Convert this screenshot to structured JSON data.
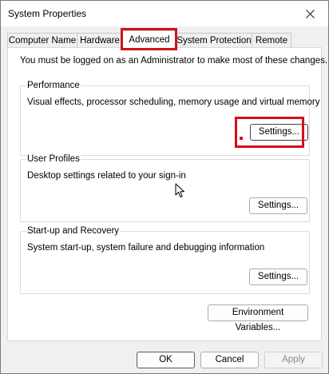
{
  "window": {
    "title": "System Properties"
  },
  "tabs": [
    {
      "label": "Computer Name"
    },
    {
      "label": "Hardware"
    },
    {
      "label": "Advanced"
    },
    {
      "label": "System Protection"
    },
    {
      "label": "Remote"
    }
  ],
  "admin_note": "You must be logged on as an Administrator to make most of these changes.",
  "groups": {
    "performance": {
      "label": "Performance",
      "description": "Visual effects, processor scheduling, memory usage and virtual memory",
      "button": "Settings..."
    },
    "user_profiles": {
      "label": "User Profiles",
      "description": "Desktop settings related to your sign-in",
      "button": "Settings..."
    },
    "startup_recovery": {
      "label": "Start-up and Recovery",
      "description": "System start-up, system failure and debugging information",
      "button": "Settings..."
    }
  },
  "env_button": "Environment Variables...",
  "footer": {
    "ok": "OK",
    "cancel": "Cancel",
    "apply": "Apply"
  },
  "colors": {
    "highlight": "#d0121b",
    "panel": "#ffffff",
    "chrome": "#f0f0f0"
  },
  "icons": {
    "close": "close-icon",
    "cursor": "mouse-cursor-icon"
  }
}
